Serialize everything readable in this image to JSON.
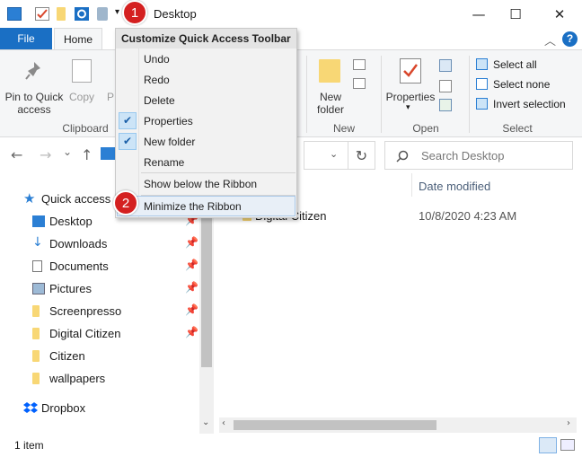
{
  "window": {
    "title": "Desktop",
    "minimize_glyph": "—",
    "maximize_glyph": "☐",
    "close_glyph": "✕"
  },
  "ribbon_tabs": {
    "file": "File",
    "home": "Home"
  },
  "ribbon": {
    "pin_quick_access": "Pin to Quick\naccess",
    "copy": "Copy",
    "paste_partial": "P",
    "clipboard_group": "Clipboard",
    "new_folder": "New\nfolder",
    "new_group": "New",
    "properties": "Properties",
    "open_group": "Open",
    "select_all": "Select all",
    "select_none": "Select none",
    "invert_selection": "Invert selection",
    "select_group": "Select"
  },
  "nav": {
    "back": "←",
    "forward": "→",
    "up": "↑",
    "recent": "⌄",
    "refresh": "↻",
    "search_placeholder": "Search Desktop"
  },
  "navpane": {
    "items": [
      {
        "label": "Quick access"
      },
      {
        "label": "Desktop"
      },
      {
        "label": "Downloads"
      },
      {
        "label": "Documents"
      },
      {
        "label": "Pictures"
      },
      {
        "label": "Screenpresso"
      },
      {
        "label": "Digital Citizen"
      },
      {
        "label": "Citizen"
      },
      {
        "label": "wallpapers"
      },
      {
        "label": "Dropbox"
      }
    ]
  },
  "content": {
    "col_date": "Date modified",
    "rows": [
      {
        "name": "Digital Citizen",
        "date": "10/8/2020 4:23 AM"
      }
    ]
  },
  "status": {
    "count": "1 item"
  },
  "menu": {
    "title": "Customize Quick Access Toolbar",
    "items": [
      {
        "label": "Undo",
        "checked": false
      },
      {
        "label": "Redo",
        "checked": false
      },
      {
        "label": "Delete",
        "checked": false
      },
      {
        "label": "Properties",
        "checked": true
      },
      {
        "label": "New folder",
        "checked": true
      },
      {
        "label": "Rename",
        "checked": false
      }
    ],
    "show_below": "Show below the Ribbon",
    "minimize": "Minimize the Ribbon"
  },
  "badges": {
    "one": "1",
    "two": "2"
  },
  "colors": {
    "file_tab": "#1a6fc4",
    "badge": "#d42020",
    "folder": "#f8d775"
  },
  "icons": [
    "window-icon",
    "properties-icon",
    "folder-icon",
    "gear-icon",
    "quick-access-icon",
    "pin-icon",
    "copy-icon",
    "new-folder-icon",
    "help-icon",
    "dropbox-icon"
  ]
}
